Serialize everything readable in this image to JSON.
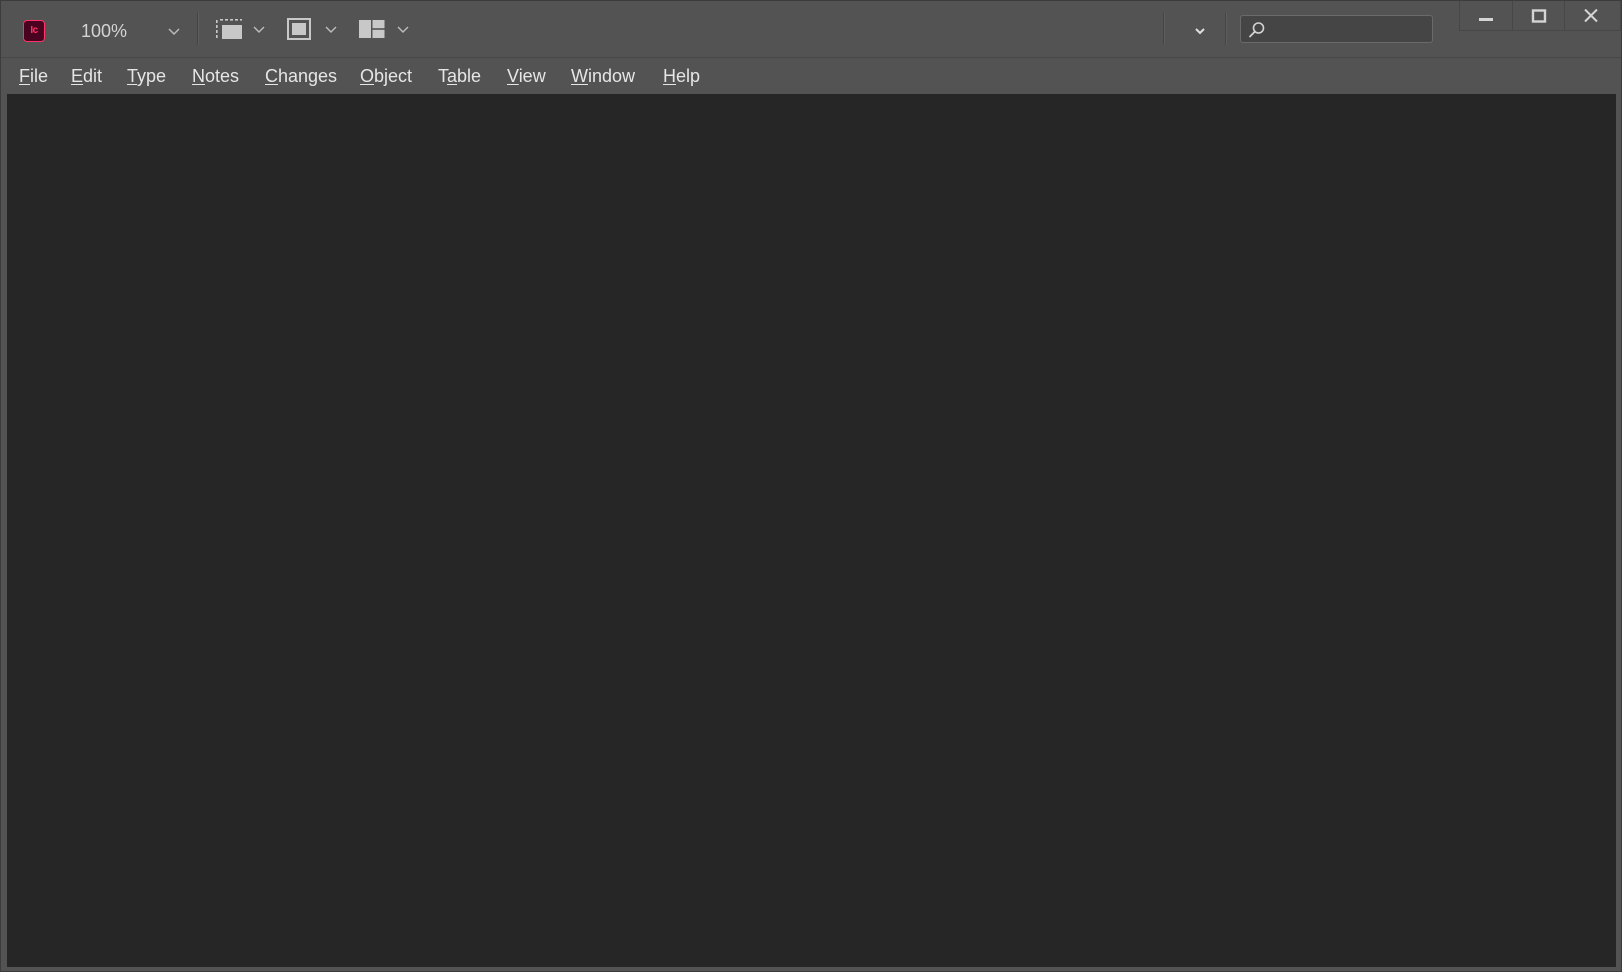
{
  "app": {
    "logo_text": "Ic",
    "brand_color": "#ff3366",
    "zoom": "100%"
  },
  "toolbar": {
    "icons": [
      "view-options-icon",
      "screen-mode-icon",
      "arrange-documents-icon"
    ],
    "workspace_dropdown_icon": "chevron-down-icon"
  },
  "search": {
    "placeholder": "",
    "value": ""
  },
  "window_controls": [
    "minimize-icon",
    "maximize-icon",
    "close-icon"
  ],
  "menu": {
    "items": [
      {
        "mnemonic": "F",
        "rest": "ile"
      },
      {
        "mnemonic": "E",
        "rest": "dit"
      },
      {
        "mnemonic": "T",
        "rest": "ype"
      },
      {
        "mnemonic": "N",
        "rest": "otes"
      },
      {
        "mnemonic": "C",
        "rest": "hanges"
      },
      {
        "mnemonic": "O",
        "rest": "bject"
      },
      {
        "pre": "T",
        "mnemonic": "a",
        "rest": "ble"
      },
      {
        "mnemonic": "V",
        "rest": "iew"
      },
      {
        "mnemonic": "W",
        "rest": "indow"
      },
      {
        "mnemonic": "H",
        "rest": "elp"
      }
    ]
  },
  "colors": {
    "chrome": "#535353",
    "workspace": "#262626",
    "text": "#e6e6e6"
  }
}
